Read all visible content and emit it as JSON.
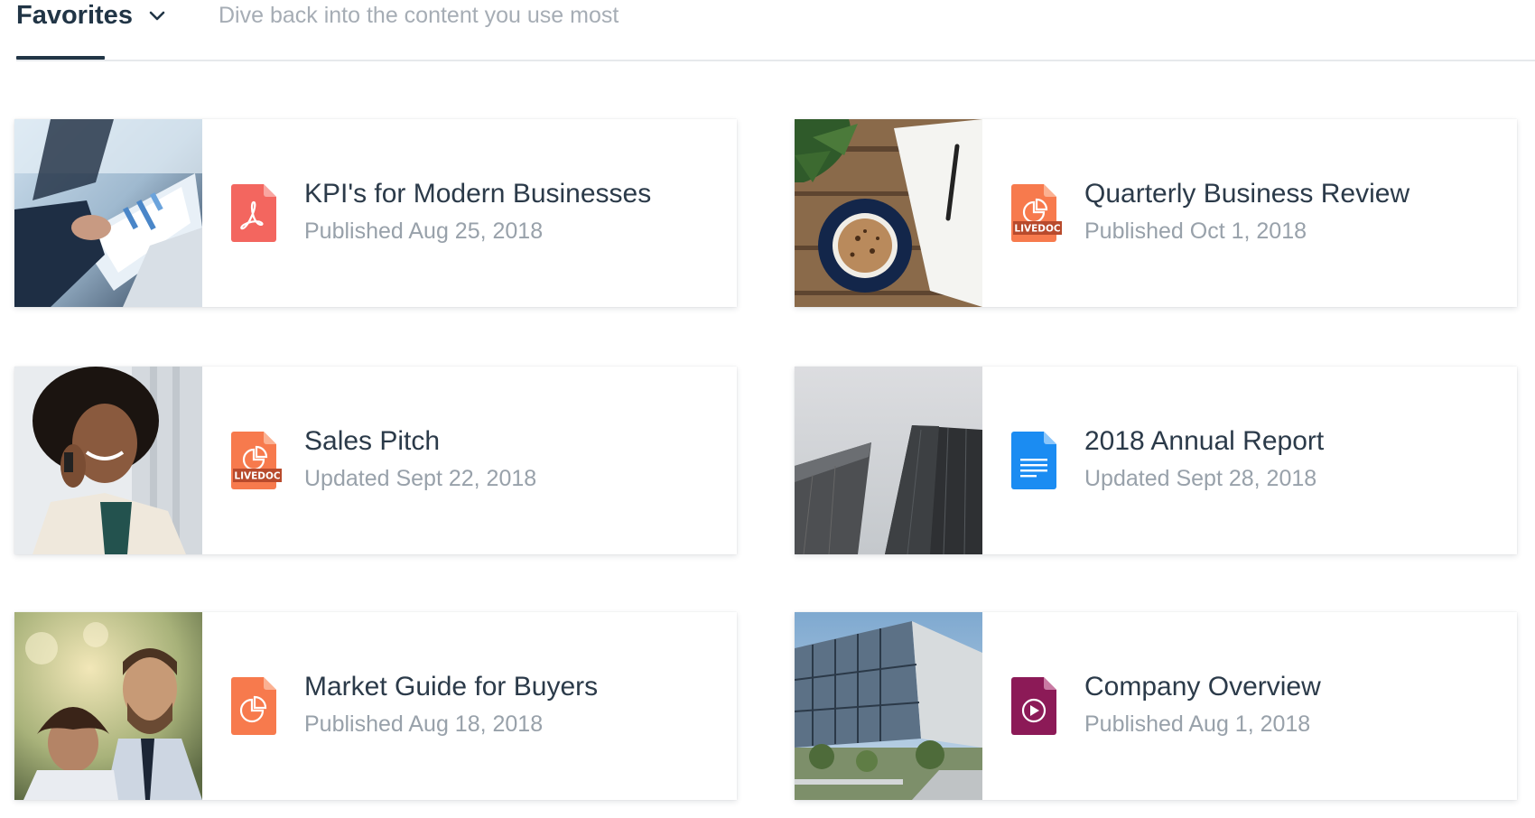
{
  "header": {
    "tab_label": "Favorites",
    "subtitle": "Dive back into the content you use most"
  },
  "cards": [
    {
      "title": "KPI's for Modern Businesses",
      "meta": "Published Aug 25, 2018",
      "file_type": "pdf"
    },
    {
      "title": "Quarterly Business Review",
      "meta": "Published Oct 1, 2018",
      "file_type": "livedoc",
      "badge": "LIVEDOC"
    },
    {
      "title": "Sales Pitch",
      "meta": "Updated Sept 22, 2018",
      "file_type": "livedoc",
      "badge": "LIVEDOC"
    },
    {
      "title": "2018 Annual Report",
      "meta": "Updated Sept 28, 2018",
      "file_type": "document"
    },
    {
      "title": "Market Guide for Buyers",
      "meta": "Published Aug 18, 2018",
      "file_type": "presentation"
    },
    {
      "title": "Company Overview",
      "meta": "Published Aug 1, 2018",
      "file_type": "video"
    }
  ],
  "colors": {
    "pdf": "#f3665f",
    "livedoc": "#f77a4d",
    "livedoc_badge": "#b84a2c",
    "presentation": "#f77a4d",
    "document": "#1b8cf2",
    "video": "#8c1a57",
    "heading": "#213546",
    "muted": "#98a1aa"
  }
}
